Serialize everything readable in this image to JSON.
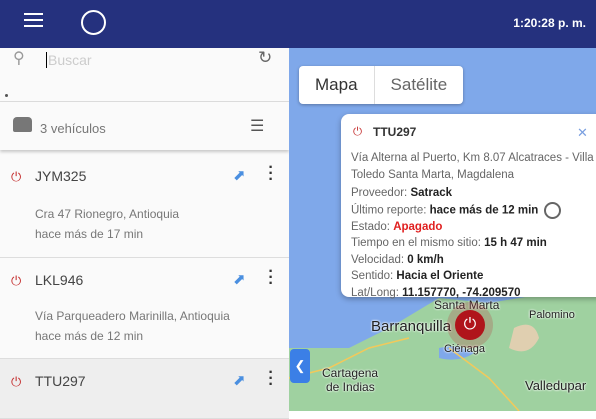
{
  "header": {
    "time": "1:20:28 p. m."
  },
  "search": {
    "placeholder": "Buscar"
  },
  "list": {
    "count": "3 vehículos",
    "items": [
      {
        "plate": "JYM325",
        "address": "Cra 47 Rionegro, Antioquia",
        "time": "hace más de 17 min"
      },
      {
        "plate": "LKL946",
        "address": "Vía Parqueadero Marinilla, Antioquia",
        "time": "hace más de 12 min"
      },
      {
        "plate": "TTU297"
      }
    ]
  },
  "map": {
    "tab_map": "Mapa",
    "tab_satellite": "Satélite",
    "labels": {
      "santa_marta": "Santa Marta",
      "barranquilla": "Barranquilla",
      "palomino": "Palomino",
      "cienaga": "Ciénaga",
      "cartagena": "Cartagena",
      "de_indias": "de Indias",
      "valledupar": "Valledupar"
    }
  },
  "popup": {
    "plate": "TTU297",
    "address1": "Vía Alterna al Puerto, Km 8.07 Alcatraces - Villa",
    "address2": "Toledo Santa Marta, Magdalena",
    "provider_label": "Proveedor:",
    "provider": "Satrack",
    "report_label": "Último reporte:",
    "report": "hace más de 12 min",
    "state_label": "Estado:",
    "state": "Apagado",
    "same_place_label": "Tiempo en el mismo sitio:",
    "same_place": "15 h 47 min",
    "speed_label": "Velocidad:",
    "speed": "0 km/h",
    "direction_label": "Sentido:",
    "direction": "Hacia el Oriente",
    "latlong_label": "Lat/Long:",
    "latlong": "11.157770, -74.209570"
  },
  "colors": {
    "header": "#25317e",
    "off": "#c53030",
    "accent": "#3b7fe6"
  }
}
